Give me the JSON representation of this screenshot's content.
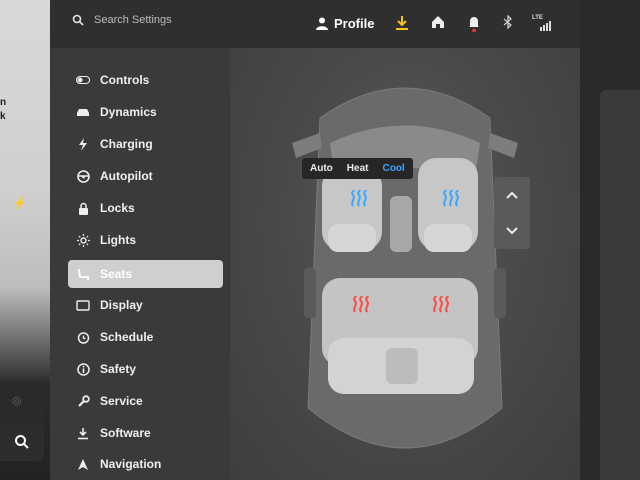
{
  "left_edge": {
    "text_line1": "n",
    "text_line2": "k"
  },
  "topbar": {
    "search_placeholder": "Search Settings",
    "profile_label": "Profile",
    "icons": [
      "search-icon",
      "person-icon",
      "download-icon",
      "home-icon",
      "bell-icon",
      "bluetooth-icon",
      "lte-signal-icon"
    ],
    "lte_label": "LTE"
  },
  "sidebar": {
    "items": [
      {
        "label": "Controls",
        "icon": "toggle-icon"
      },
      {
        "label": "Dynamics",
        "icon": "car-icon"
      },
      {
        "label": "Charging",
        "icon": "bolt-icon"
      },
      {
        "label": "Autopilot",
        "icon": "steering-wheel-icon"
      },
      {
        "label": "Locks",
        "icon": "lock-icon"
      },
      {
        "label": "Lights",
        "icon": "sun-icon"
      },
      {
        "label": "Seats",
        "icon": "seat-icon",
        "active": true
      },
      {
        "label": "Display",
        "icon": "display-icon"
      },
      {
        "label": "Schedule",
        "icon": "clock-icon"
      },
      {
        "label": "Safety",
        "icon": "info-icon"
      },
      {
        "label": "Service",
        "icon": "wrench-icon"
      },
      {
        "label": "Software",
        "icon": "download-icon"
      },
      {
        "label": "Navigation",
        "icon": "navigation-icon"
      }
    ]
  },
  "climate_modes": {
    "options": [
      "Auto",
      "Heat",
      "Cool"
    ],
    "selected": "Cool"
  },
  "seats": {
    "front_left": "cool",
    "front_right": "cool",
    "rear_left": "heat",
    "rear_right": "heat"
  },
  "colors": {
    "cool": "#3aa6ff",
    "heat": "#ff4a3d",
    "active_item_bg": "#cfcfcf",
    "notification_dot": "#e53935",
    "download_icon": "#f5c518"
  }
}
